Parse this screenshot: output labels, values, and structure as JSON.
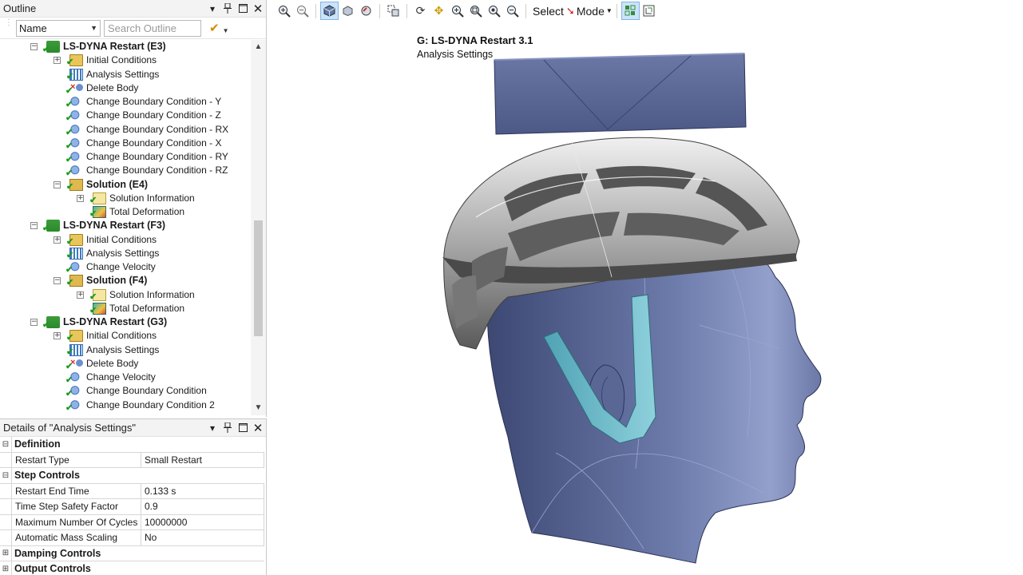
{
  "outline": {
    "title": "Outline",
    "filter_name": "Name",
    "search_placeholder": "Search Outline",
    "tree": [
      {
        "label": "LS-DYNA Restart (E3)",
        "bold": true,
        "level": 0,
        "icon": "analysis-icon",
        "expander": "−"
      },
      {
        "label": "Initial Conditions",
        "level": 1,
        "icon": "initial-conditions-icon",
        "expander": "+"
      },
      {
        "label": "Analysis Settings",
        "level": 1,
        "icon": "analysis-settings-icon"
      },
      {
        "label": "Delete Body",
        "level": 1,
        "icon": "delete-body-icon"
      },
      {
        "label": "Change Boundary Condition - Y",
        "level": 1,
        "icon": "boundary-condition-icon"
      },
      {
        "label": "Change Boundary Condition - Z",
        "level": 1,
        "icon": "boundary-condition-icon"
      },
      {
        "label": "Change Boundary Condition - RX",
        "level": 1,
        "icon": "boundary-condition-icon"
      },
      {
        "label": "Change Boundary Condition - X",
        "level": 1,
        "icon": "boundary-condition-icon"
      },
      {
        "label": "Change Boundary Condition - RY",
        "level": 1,
        "icon": "boundary-condition-icon"
      },
      {
        "label": "Change Boundary Condition - RZ",
        "level": 1,
        "icon": "boundary-condition-icon"
      },
      {
        "label": "Solution (E4)",
        "bold": true,
        "level": 1,
        "icon": "solution-icon",
        "expander": "−"
      },
      {
        "label": "Solution Information",
        "level": 2,
        "icon": "solution-information-icon",
        "expander": "+"
      },
      {
        "label": "Total Deformation",
        "level": 2,
        "icon": "total-deformation-icon"
      },
      {
        "label": "LS-DYNA Restart (F3)",
        "bold": true,
        "level": 0,
        "icon": "analysis-icon",
        "expander": "−"
      },
      {
        "label": "Initial Conditions",
        "level": 1,
        "icon": "initial-conditions-icon",
        "expander": "+"
      },
      {
        "label": "Analysis Settings",
        "level": 1,
        "icon": "analysis-settings-icon"
      },
      {
        "label": "Change Velocity",
        "level": 1,
        "icon": "boundary-condition-icon"
      },
      {
        "label": "Solution (F4)",
        "bold": true,
        "level": 1,
        "icon": "solution-icon",
        "expander": "−"
      },
      {
        "label": "Solution Information",
        "level": 2,
        "icon": "solution-information-icon",
        "expander": "+"
      },
      {
        "label": "Total Deformation",
        "level": 2,
        "icon": "total-deformation-icon"
      },
      {
        "label": "LS-DYNA Restart (G3)",
        "bold": true,
        "level": 0,
        "icon": "analysis-icon",
        "expander": "−"
      },
      {
        "label": "Initial Conditions",
        "level": 1,
        "icon": "initial-conditions-icon",
        "expander": "+"
      },
      {
        "label": "Analysis Settings",
        "level": 1,
        "icon": "analysis-settings-icon"
      },
      {
        "label": "Delete Body",
        "level": 1,
        "icon": "delete-body-icon"
      },
      {
        "label": "Change Velocity",
        "level": 1,
        "icon": "boundary-condition-icon"
      },
      {
        "label": "Change Boundary Condition",
        "level": 1,
        "icon": "boundary-condition-icon"
      },
      {
        "label": "Change Boundary Condition 2",
        "level": 1,
        "icon": "boundary-condition-icon"
      }
    ]
  },
  "details": {
    "title": "Details of \"Analysis Settings\"",
    "sections": [
      {
        "label": "Definition",
        "expander": "−",
        "rows": [
          {
            "key": "Restart Type",
            "value": "Small Restart"
          }
        ]
      },
      {
        "label": "Step Controls",
        "expander": "−",
        "rows": [
          {
            "key": "Restart End Time",
            "value": "0.133 s"
          },
          {
            "key": "Time Step Safety Factor",
            "value": "0.9"
          },
          {
            "key": "Maximum Number Of Cycles",
            "value": "10000000"
          },
          {
            "key": "Automatic Mass Scaling",
            "value": "No"
          }
        ]
      },
      {
        "label": "Damping Controls",
        "expander": "+",
        "rows": []
      },
      {
        "label": "Output Controls",
        "expander": "+",
        "rows": []
      }
    ]
  },
  "toolbar": {
    "select_label": "Select",
    "mode_label": "Mode"
  },
  "viewport": {
    "title": "G: LS-DYNA Restart 3.1",
    "subtitle": "Analysis Settings"
  }
}
